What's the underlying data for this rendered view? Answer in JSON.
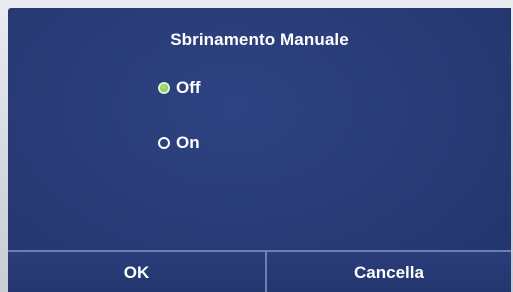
{
  "dialog": {
    "title": "Sbrinamento Manuale",
    "options": [
      {
        "label": "Off",
        "selected": true
      },
      {
        "label": "On",
        "selected": false
      }
    ],
    "buttons": {
      "ok_label": "OK",
      "cancel_label": "Cancella"
    }
  },
  "colors": {
    "screen_background": "#283b76",
    "text": "#ffffff",
    "radio_selected": "#8ccc63",
    "button_separator": "#6c7fb5"
  }
}
